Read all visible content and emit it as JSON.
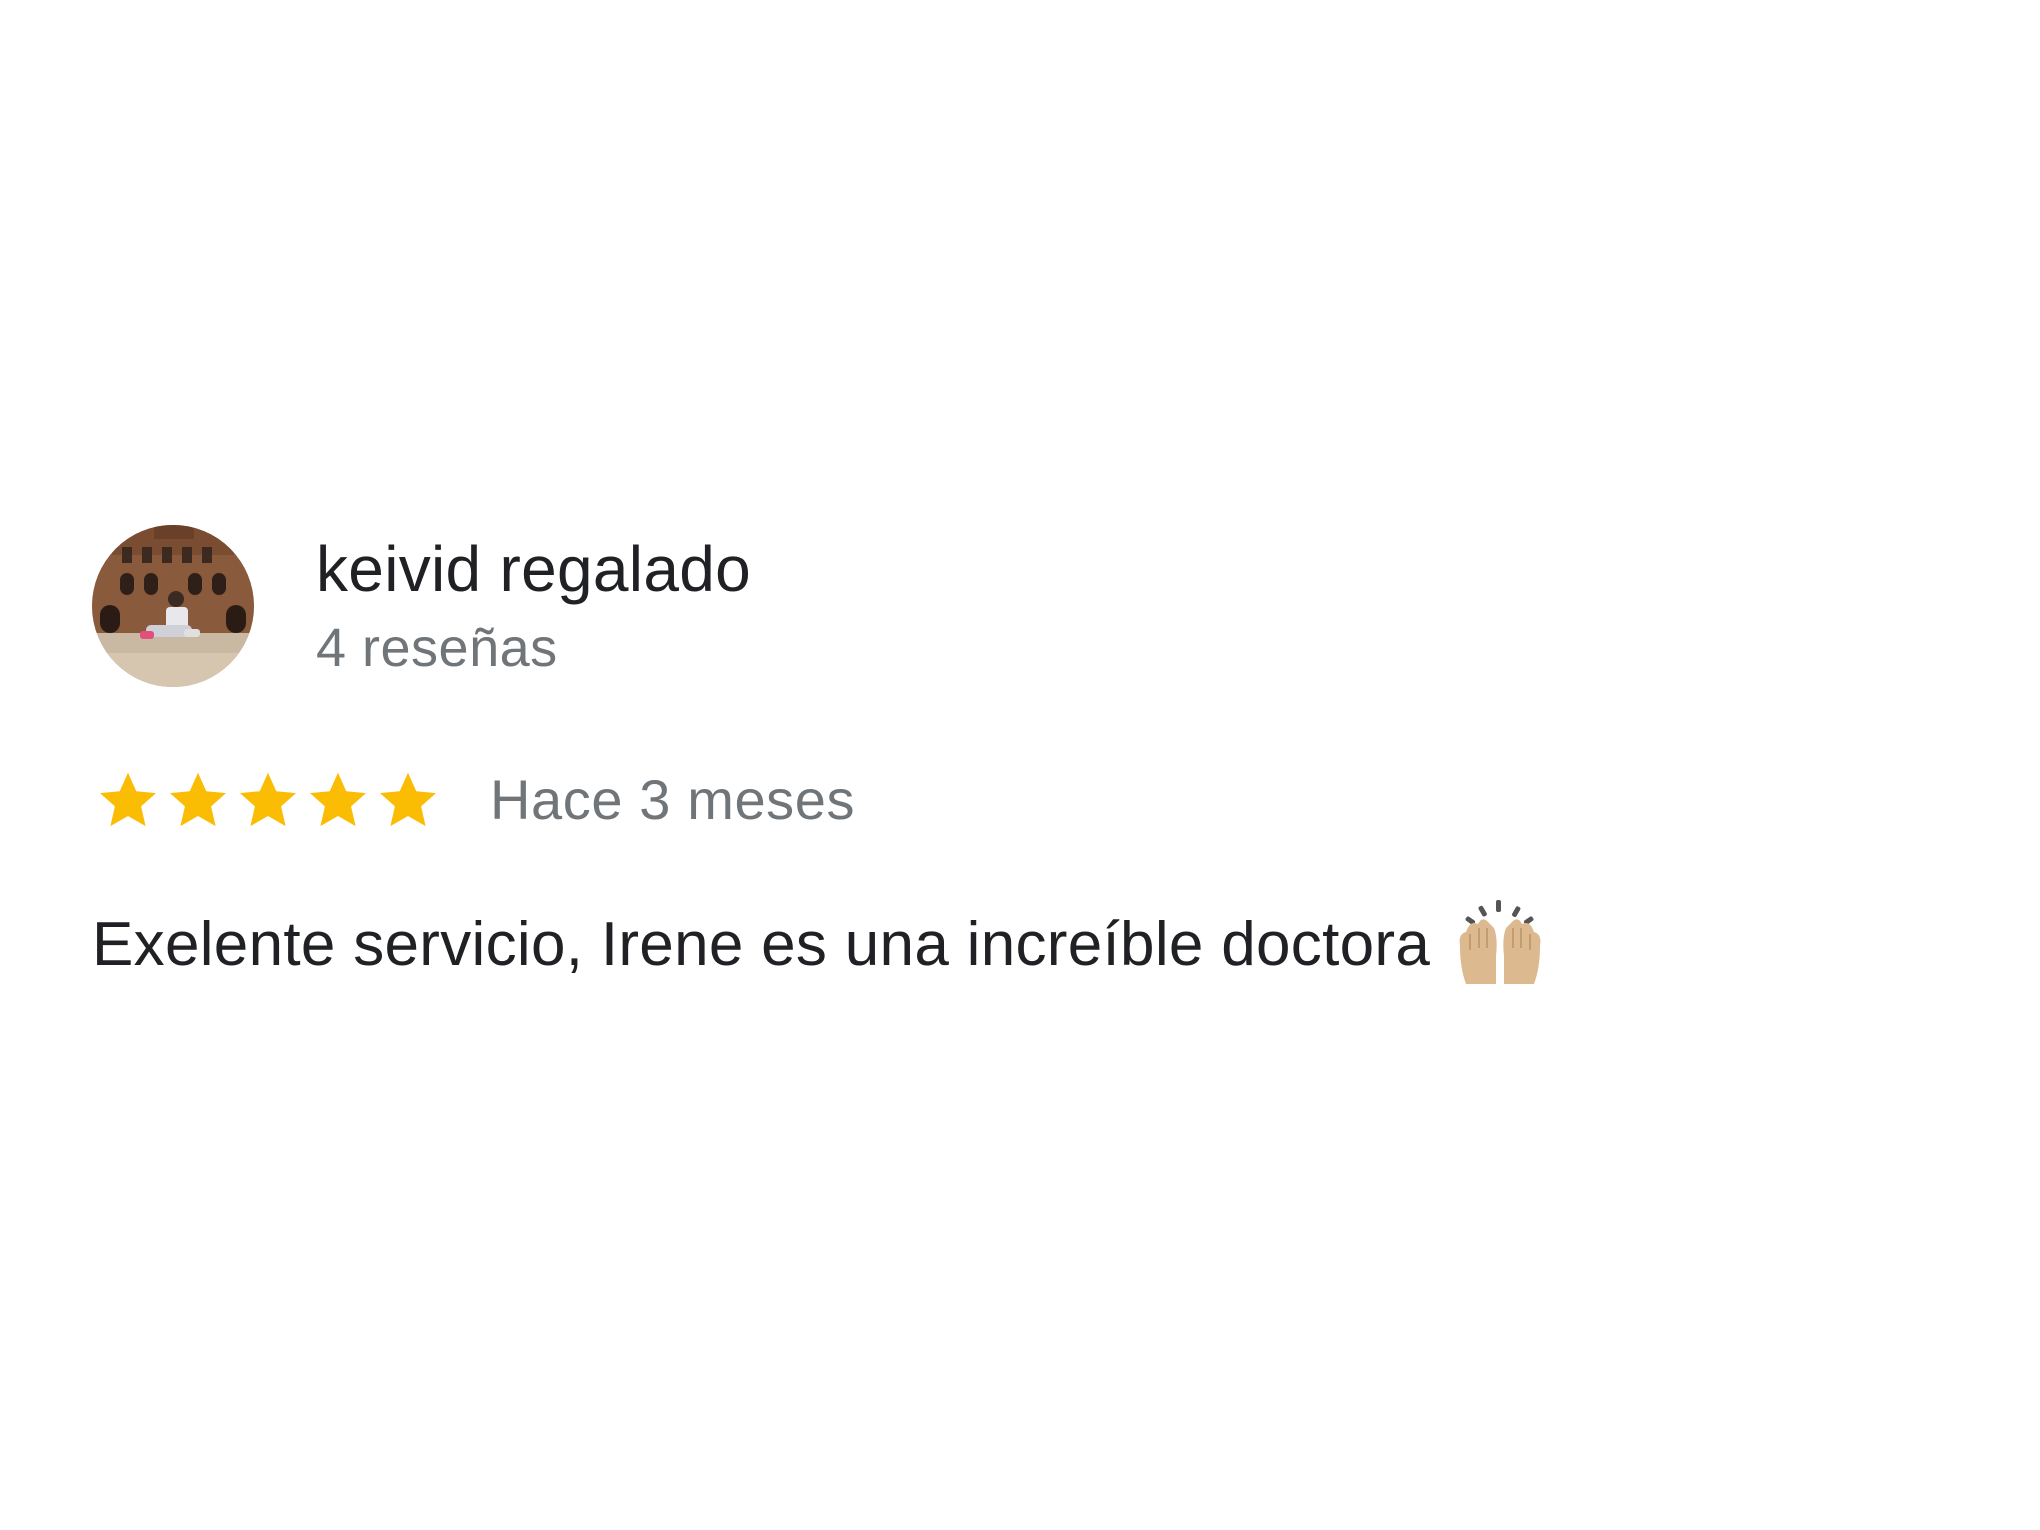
{
  "review": {
    "author": {
      "name": "keivid regalado",
      "meta": "4 reseñas",
      "avatar_icon": "profile-photo"
    },
    "rating": {
      "stars": 5,
      "max": 5,
      "star_color": "#FBBC04"
    },
    "date": "Hace 3 meses",
    "text": "Exelente servicio, Irene es una increíble doctora",
    "emoji_icon": "raising-hands-icon"
  }
}
